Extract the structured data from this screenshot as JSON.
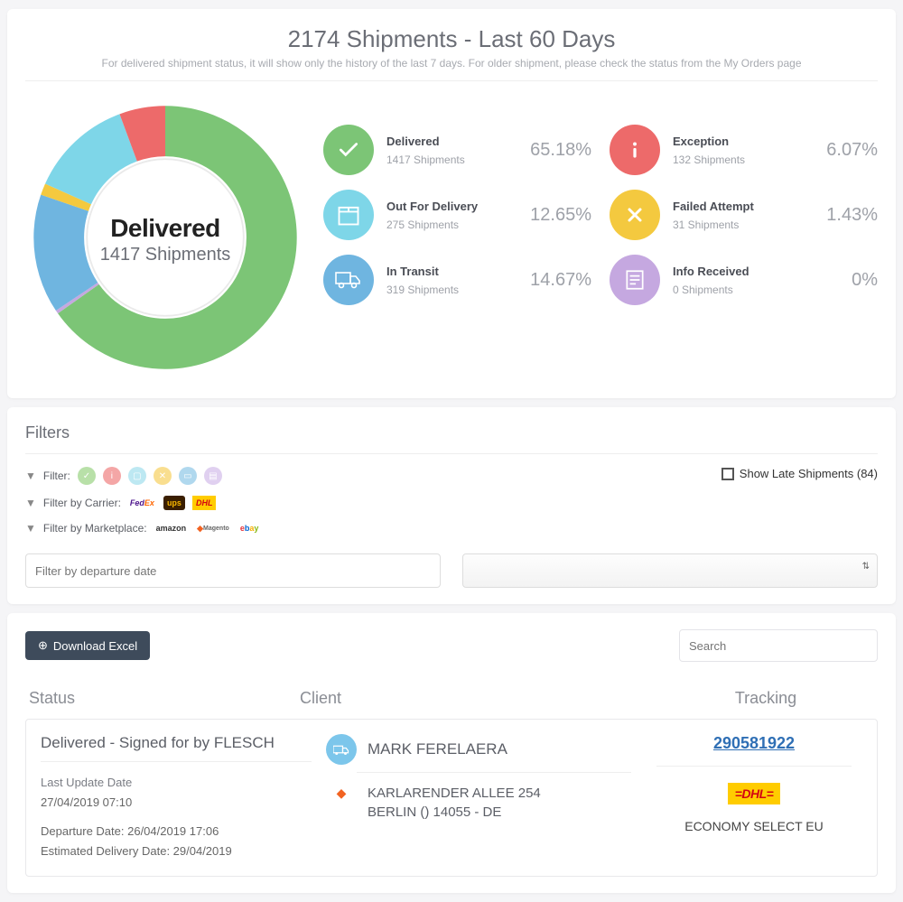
{
  "header": {
    "title": "2174 Shipments - Last 60 Days",
    "subtitle": "For delivered shipment status, it will show only the history of the last 7 days. For older shipment, please check the status from the My Orders page"
  },
  "donut": {
    "center_label": "Delivered",
    "center_count": "1417 Shipments"
  },
  "chart_data": {
    "type": "pie",
    "title": "Shipment status distribution (last 60 days)",
    "series": [
      {
        "name": "Delivered",
        "value": 1417,
        "percent": 65.18,
        "color": "#7cc576"
      },
      {
        "name": "Out For Delivery",
        "value": 275,
        "percent": 12.65,
        "color": "#7ed6e8"
      },
      {
        "name": "In Transit",
        "value": 319,
        "percent": 14.67,
        "color": "#6fb5e0"
      },
      {
        "name": "Exception",
        "value": 132,
        "percent": 6.07,
        "color": "#ed6a6a"
      },
      {
        "name": "Failed Attempt",
        "value": 31,
        "percent": 1.43,
        "color": "#f4c93f"
      },
      {
        "name": "Info Received",
        "value": 0,
        "percent": 0,
        "color": "#c5a8e0"
      }
    ],
    "total": 2174
  },
  "stats": [
    {
      "title": "Delivered",
      "sub": "1417 Shipments",
      "pct": "65.18%",
      "color": "#7cc576",
      "icon": "check"
    },
    {
      "title": "Exception",
      "sub": "132 Shipments",
      "pct": "6.07%",
      "color": "#ed6a6a",
      "icon": "info"
    },
    {
      "title": "Out For Delivery",
      "sub": "275 Shipments",
      "pct": "12.65%",
      "color": "#7ed6e8",
      "icon": "box"
    },
    {
      "title": "Failed Attempt",
      "sub": "31 Shipments",
      "pct": "1.43%",
      "color": "#f4c93f",
      "icon": "cross"
    },
    {
      "title": "In Transit",
      "sub": "319 Shipments",
      "pct": "14.67%",
      "color": "#6fb5e0",
      "icon": "truck"
    },
    {
      "title": "Info Received",
      "sub": "0 Shipments",
      "pct": "0%",
      "color": "#c5a8e0",
      "icon": "doc"
    }
  ],
  "filters": {
    "title": "Filters",
    "filter_label": "Filter:",
    "carrier_label": "Filter by Carrier:",
    "carriers": [
      "FedEx",
      "UPS",
      "DHL"
    ],
    "marketplace_label": "Filter by Marketplace:",
    "marketplaces": [
      "amazon",
      "Magento",
      "ebay"
    ],
    "late_label": "Show Late Shipments (84)",
    "date_placeholder": "Filter by departure date"
  },
  "table": {
    "download_label": "Download Excel",
    "search_placeholder": "Search",
    "headers": {
      "status": "Status",
      "client": "Client",
      "tracking": "Tracking"
    },
    "row": {
      "status_title": "Delivered - Signed for by FLESCH",
      "last_update_label": "Last Update Date",
      "last_update_value": "27/04/2019 07:10",
      "departure": "Departure Date: 26/04/2019 17:06",
      "estimated": "Estimated Delivery Date: 29/04/2019",
      "client_name": "MARK FERELAERA",
      "address_line1": "KARLARENDER ALLEE 254",
      "address_line2": "BERLIN () 14055 - DE",
      "tracking_number": "290581922",
      "carrier": "DHL",
      "method": "ECONOMY SELECT EU"
    }
  }
}
